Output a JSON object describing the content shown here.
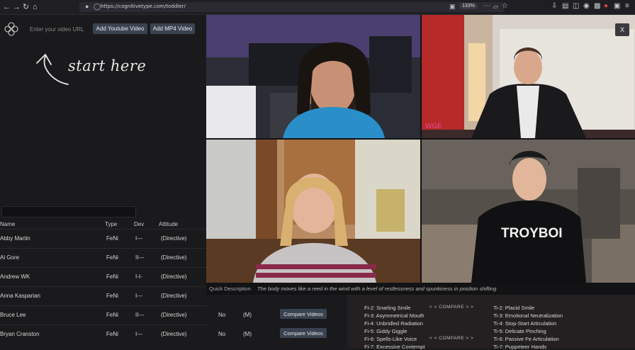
{
  "browser": {
    "url": "https://cognitivetype.com/toddler/",
    "zoom": "133%"
  },
  "left": {
    "url_placeholder": "Enter your video URL",
    "add_youtube_label": "Add Youtube Video",
    "add_mp4_label": "Add MP4 Video",
    "hint_text": "start here"
  },
  "table": {
    "headers": {
      "name": "Name",
      "type": "Type",
      "dev": "Dev",
      "attitude": "Attitude"
    },
    "rows": [
      {
        "name": "Abby Martin",
        "type": "FeNi",
        "dev": "I---",
        "attitude": "(Directive)"
      },
      {
        "name": "Al Gore",
        "type": "FeNi",
        "dev": "II---",
        "attitude": "(Directive)"
      },
      {
        "name": "Andrew WK",
        "type": "FeNi",
        "dev": "I-I-",
        "attitude": "(Directive)"
      },
      {
        "name": "Anna Kasparian",
        "type": "FeNi",
        "dev": "I---",
        "attitude": "(Directive)"
      },
      {
        "name": "Bruce Lee",
        "type": "FeNi",
        "dev": "II---",
        "attitude": "(Directive)"
      },
      {
        "name": "Bryan Cranston",
        "type": "FeNi",
        "dev": "I---",
        "attitude": "(Directive)"
      }
    ],
    "extra": [
      {
        "yn": "No",
        "m": "(M)",
        "compare": "Compare Videos"
      },
      {
        "yn": "No",
        "m": "(M)",
        "compare": "Compare Videos"
      }
    ]
  },
  "overlay": {
    "close_label": "X",
    "quick_label": "Quick Description",
    "quick_text": "The body moves like a reed in the wind with a level of restlessness and spunkiness in position shifting"
  },
  "traits": {
    "left": [
      "Fi-2: Snarling Smile",
      "Fi-3: Asymmetrical Mouth",
      "Fi-4: Unbridled Radiation",
      "Fi-5: Giddy Giggle",
      "Fi-6: Spells-Like Voice",
      "Fi-7: Excessive Contempt"
    ],
    "right": [
      "Ti-2: Placid Smile",
      "Ti-3: Emotional Neutralization",
      "Ti-4: Stop-Start Articulation",
      "Ti-5: Delicate Pinching",
      "Ti-6: Passive Fe Articulation",
      "Ti-7: Puppeteer Hands"
    ],
    "compare_label": "< < COMPARE > >"
  },
  "colors": {
    "accent_button": "#3a4350",
    "background": "#1a1a1c",
    "panel": "#242021"
  }
}
